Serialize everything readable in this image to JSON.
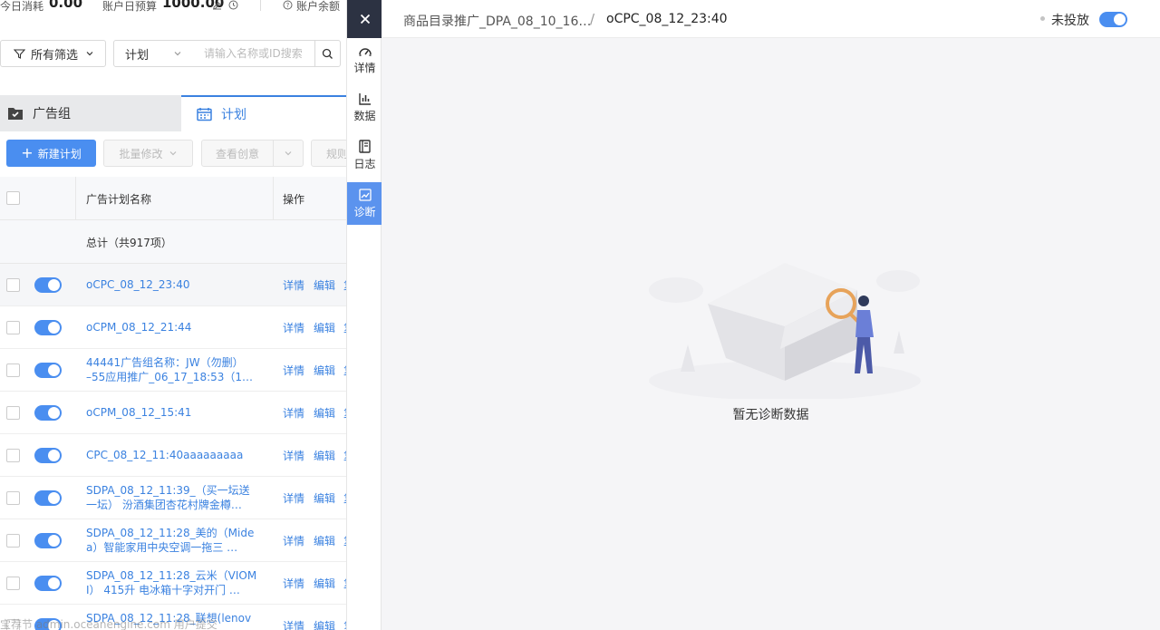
{
  "stats": {
    "today_spend_label": "今日消耗",
    "today_spend_value": "0.00",
    "daily_budget_label": "账户日预算",
    "daily_budget_value": "1000.00",
    "balance_label": "账户余额"
  },
  "filters": {
    "all_filters_label": "所有筛选",
    "plan_select_value": "计划",
    "search_placeholder": "请输入名称或ID搜索"
  },
  "tabs": {
    "ad_group_label": "广告组",
    "plan_label": "计划"
  },
  "actions": {
    "new_plan_label": "新建计划",
    "batch_edit_label": "批量修改",
    "view_creative_label": "查看创意",
    "rules_label": "规则"
  },
  "table": {
    "col_name": "广告计划名称",
    "col_op": "操作",
    "total_label": "总计（共917项）",
    "detail_label": "详情",
    "edit_label": "编辑",
    "rows": [
      {
        "line1": "oCPC_08_12_23:40",
        "line2": ""
      },
      {
        "line1": "oCPM_08_12_21:44",
        "line2": ""
      },
      {
        "line1": "44441广告组名称：JW（勿删）",
        "line2": "–55应用推广_06_17_18:53（1…"
      },
      {
        "line1": "oCPM_08_12_15:41",
        "line2": ""
      },
      {
        "line1": "CPC_08_12_11:40aaaaaaaaa",
        "line2": ""
      },
      {
        "line1": "SDPA_08_12_11:39_（买一坛送",
        "line2": "一坛） 汾酒集团杏花村牌金樽…"
      },
      {
        "line1": "SDPA_08_12_11:28_美的（Mide",
        "line2": "a）智能家用中央空调一拖三 …"
      },
      {
        "line1": "SDPA_08_12_11:28_云米（VIOM",
        "line2": "I） 415升 电冰箱十字对开门 …"
      },
      {
        "line1": "SDPA_08_12_11:28_联想(lenov",
        "line2": ""
      }
    ]
  },
  "sidebar": {
    "items": [
      {
        "label": "详情",
        "icon": "gauge-icon"
      },
      {
        "label": "数据",
        "icon": "bar-chart-icon"
      },
      {
        "label": "日志",
        "icon": "log-book-icon"
      },
      {
        "label": "诊断",
        "icon": "diagnosis-chart-icon"
      }
    ]
  },
  "drawer": {
    "breadcrumb_parent": "商品目录推广_DPA_08_10_16…",
    "breadcrumb_separator": "/",
    "breadcrumb_current": "oCPC_08_12_23:40",
    "status_text": "未投放",
    "empty_text": "暂无诊断数据"
  },
  "watermark": "宝荐节 admin.oceanengine.com 用户提交",
  "colors": {
    "accent": "#4a8ef0",
    "link": "#3b82e0",
    "sidebar_dark": "#2c3242",
    "sidebar_active": "#5b93ee"
  }
}
